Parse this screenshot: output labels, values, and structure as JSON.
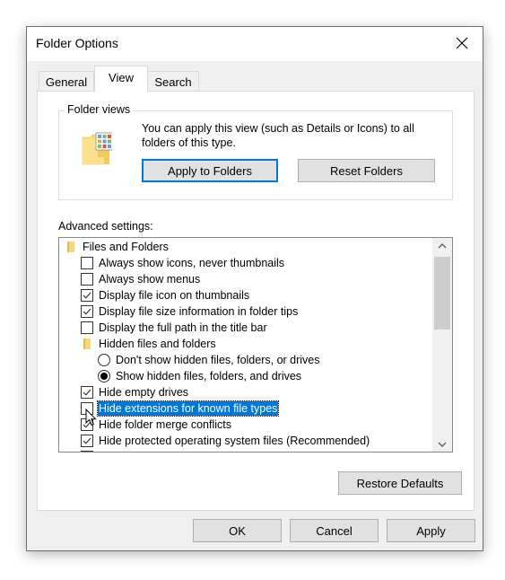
{
  "window": {
    "title": "Folder Options",
    "close_icon": "close-icon"
  },
  "tabs": [
    {
      "label": "General",
      "selected": false
    },
    {
      "label": "View",
      "selected": true
    },
    {
      "label": "Search",
      "selected": false
    }
  ],
  "folder_views": {
    "group_label": "Folder views",
    "description": "You can apply this view (such as Details or Icons) to all folders of this type.",
    "icon": "folder-views-icon",
    "apply_button": "Apply to Folders",
    "reset_button": "Reset Folders"
  },
  "advanced": {
    "label": "Advanced settings:",
    "items": [
      {
        "type": "folder",
        "level": 0,
        "label": "Files and Folders"
      },
      {
        "type": "checkbox",
        "level": 1,
        "label": "Always show icons, never thumbnails",
        "checked": false
      },
      {
        "type": "checkbox",
        "level": 1,
        "label": "Always show menus",
        "checked": false
      },
      {
        "type": "checkbox",
        "level": 1,
        "label": "Display file icon on thumbnails",
        "checked": true
      },
      {
        "type": "checkbox",
        "level": 1,
        "label": "Display file size information in folder tips",
        "checked": true
      },
      {
        "type": "checkbox",
        "level": 1,
        "label": "Display the full path in the title bar",
        "checked": false
      },
      {
        "type": "folder",
        "level": 1,
        "label": "Hidden files and folders"
      },
      {
        "type": "radio",
        "level": 2,
        "label": "Don't show hidden files, folders, or drives",
        "checked": false
      },
      {
        "type": "radio",
        "level": 2,
        "label": "Show hidden files, folders, and drives",
        "checked": true
      },
      {
        "type": "checkbox",
        "level": 1,
        "label": "Hide empty drives",
        "checked": true
      },
      {
        "type": "checkbox",
        "level": 1,
        "label": "Hide extensions for known file types",
        "checked": false,
        "selected": true
      },
      {
        "type": "checkbox",
        "level": 1,
        "label": "Hide folder merge conflicts",
        "checked": true
      },
      {
        "type": "checkbox",
        "level": 1,
        "label": "Hide protected operating system files (Recommended)",
        "checked": true
      },
      {
        "type": "checkbox",
        "level": 1,
        "label": "",
        "checked": false
      }
    ],
    "scroll_position": 0.0
  },
  "restore_defaults": "Restore Defaults",
  "footer": {
    "ok": "OK",
    "cancel": "Cancel",
    "apply": "Apply"
  },
  "colors": {
    "accent": "#0078d7",
    "folder": "#f8d775"
  }
}
